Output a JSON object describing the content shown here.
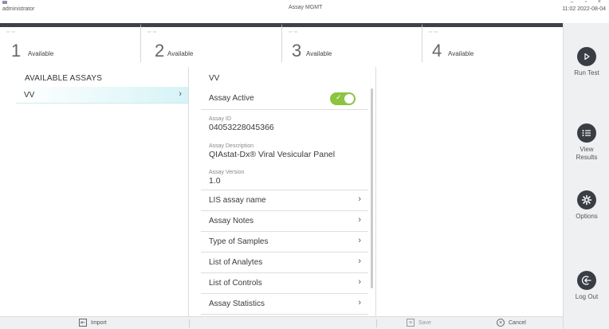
{
  "titlebar": {
    "user": "administrator",
    "title": "Assay MGMT",
    "clock": "11:02 2022-08-04",
    "window_controls": "– ▫ ×"
  },
  "modules": [
    {
      "num": "1",
      "status": "Available"
    },
    {
      "num": "2",
      "status": "Available"
    },
    {
      "num": "3",
      "status": "Available"
    },
    {
      "num": "4",
      "status": "Available"
    }
  ],
  "sidebar": {
    "run_test": "Run Test",
    "view_results": "View Results",
    "options": "Options",
    "log_out": "Log Out"
  },
  "assays": {
    "title": "AVAILABLE ASSAYS",
    "items": [
      {
        "name": "VV"
      }
    ]
  },
  "detail": {
    "title": "VV",
    "assay_active_label": "Assay Active",
    "assay_active_on": true,
    "assay_id_label": "Assay ID",
    "assay_id": "04053228045366",
    "assay_description_label": "Assay Description",
    "assay_description": "QIAstat-Dx® Viral Vesicular Panel",
    "assay_version_label": "Assay Version",
    "assay_version": "1.0",
    "rows": [
      {
        "label": "LIS assay name"
      },
      {
        "label": "Assay Notes"
      },
      {
        "label": "Type of Samples"
      },
      {
        "label": "List of Analytes"
      },
      {
        "label": "List of Controls"
      },
      {
        "label": "Assay Statistics"
      }
    ]
  },
  "footer": {
    "import": "Import",
    "save": "Save",
    "cancel": "Cancel"
  },
  "colors": {
    "toggle_on": "#8cc43f",
    "selection": "#d6f3f7",
    "dark": "#3e4149"
  }
}
